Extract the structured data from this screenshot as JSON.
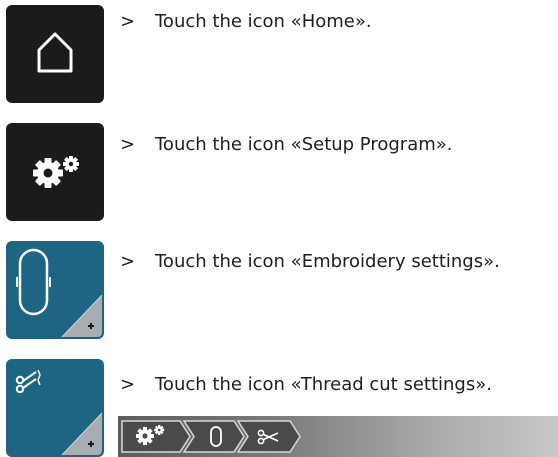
{
  "steps": [
    {
      "marker": ">",
      "text": "Touch the icon «Home»."
    },
    {
      "marker": ">",
      "text": "Touch the icon «Setup Program»."
    },
    {
      "marker": ">",
      "text": "Touch the icon «Embroidery settings»."
    },
    {
      "marker": ">",
      "text": "Touch the icon «Thread cut settings»."
    }
  ],
  "icons": {
    "home": "home-icon",
    "setup": "gears-icon",
    "embroidery": "embroidery-hoop-icon",
    "thread_cut": "scissors-icon"
  },
  "breadcrumb": {
    "items": [
      "gears-icon",
      "embroidery-hoop-icon",
      "scissors-icon"
    ]
  },
  "colors": {
    "dark_button": "#1b1b1b",
    "blue_button": "#1e6483"
  }
}
